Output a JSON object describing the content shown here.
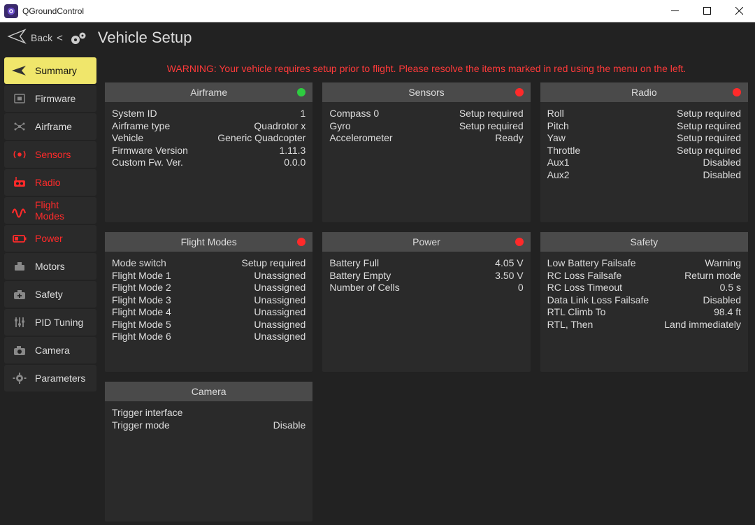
{
  "window": {
    "title": "QGroundControl"
  },
  "header": {
    "back": "Back",
    "title": "Vehicle Setup"
  },
  "warning": "WARNING: Your vehicle requires setup prior to flight. Please resolve the items marked in red using the menu on the left.",
  "sidebar": [
    {
      "id": "summary",
      "label": "Summary",
      "icon": "plane-icon",
      "selected": true,
      "warn": false
    },
    {
      "id": "firmware",
      "label": "Firmware",
      "icon": "chip-icon",
      "selected": false,
      "warn": false
    },
    {
      "id": "airframe",
      "label": "Airframe",
      "icon": "airframe-icon",
      "selected": false,
      "warn": false
    },
    {
      "id": "sensors",
      "label": "Sensors",
      "icon": "sensors-icon",
      "selected": false,
      "warn": true
    },
    {
      "id": "radio",
      "label": "Radio",
      "icon": "radio-icon",
      "selected": false,
      "warn": true
    },
    {
      "id": "flightmodes",
      "label": "Flight Modes",
      "icon": "wave-icon",
      "selected": false,
      "warn": true
    },
    {
      "id": "power",
      "label": "Power",
      "icon": "battery-icon",
      "selected": false,
      "warn": true
    },
    {
      "id": "motors",
      "label": "Motors",
      "icon": "motor-icon",
      "selected": false,
      "warn": false
    },
    {
      "id": "safety",
      "label": "Safety",
      "icon": "medkit-icon",
      "selected": false,
      "warn": false
    },
    {
      "id": "pidtuning",
      "label": "PID Tuning",
      "icon": "sliders-icon",
      "selected": false,
      "warn": false
    },
    {
      "id": "camera",
      "label": "Camera",
      "icon": "camera-icon",
      "selected": false,
      "warn": false
    },
    {
      "id": "parameters",
      "label": "Parameters",
      "icon": "gear-icon",
      "selected": false,
      "warn": false
    }
  ],
  "cards": [
    {
      "id": "airframe",
      "title": "Airframe",
      "status": "green",
      "rows": [
        {
          "k": "System ID",
          "v": "1"
        },
        {
          "k": "Airframe type",
          "v": "Quadrotor x"
        },
        {
          "k": "Vehicle",
          "v": "Generic Quadcopter"
        },
        {
          "k": "Firmware Version",
          "v": "1.11.3"
        },
        {
          "k": "Custom Fw. Ver.",
          "v": "0.0.0"
        }
      ]
    },
    {
      "id": "sensors",
      "title": "Sensors",
      "status": "red",
      "rows": [
        {
          "k": "Compass 0",
          "v": "Setup required"
        },
        {
          "k": "Gyro",
          "v": "Setup required"
        },
        {
          "k": "Accelerometer",
          "v": "Ready"
        }
      ]
    },
    {
      "id": "radio",
      "title": "Radio",
      "status": "red",
      "rows": [
        {
          "k": "Roll",
          "v": "Setup required"
        },
        {
          "k": "Pitch",
          "v": "Setup required"
        },
        {
          "k": "Yaw",
          "v": "Setup required"
        },
        {
          "k": "Throttle",
          "v": "Setup required"
        },
        {
          "k": "Aux1",
          "v": "Disabled"
        },
        {
          "k": "Aux2",
          "v": "Disabled"
        }
      ]
    },
    {
      "id": "flightmodes",
      "title": "Flight Modes",
      "status": "red",
      "rows": [
        {
          "k": "Mode switch",
          "v": "Setup required"
        },
        {
          "k": "Flight Mode 1",
          "v": "Unassigned"
        },
        {
          "k": "Flight Mode 2",
          "v": "Unassigned"
        },
        {
          "k": "Flight Mode 3",
          "v": "Unassigned"
        },
        {
          "k": "Flight Mode 4",
          "v": "Unassigned"
        },
        {
          "k": "Flight Mode 5",
          "v": "Unassigned"
        },
        {
          "k": "Flight Mode 6",
          "v": "Unassigned"
        }
      ]
    },
    {
      "id": "power",
      "title": "Power",
      "status": "red",
      "rows": [
        {
          "k": "Battery Full",
          "v": "4.05 V"
        },
        {
          "k": "Battery Empty",
          "v": "3.50 V"
        },
        {
          "k": "Number of Cells",
          "v": "0"
        }
      ]
    },
    {
      "id": "safety",
      "title": "Safety",
      "status": "none",
      "rows": [
        {
          "k": "Low Battery Failsafe",
          "v": "Warning"
        },
        {
          "k": "RC Loss Failsafe",
          "v": "Return mode"
        },
        {
          "k": "RC Loss Timeout",
          "v": "0.5 s"
        },
        {
          "k": "Data Link Loss Failsafe",
          "v": "Disabled"
        },
        {
          "k": "RTL Climb To",
          "v": "98.4 ft"
        },
        {
          "k": "RTL, Then",
          "v": "Land immediately"
        }
      ]
    },
    {
      "id": "camera",
      "title": "Camera",
      "status": "none",
      "rows": [
        {
          "k": "Trigger interface",
          "v": ""
        },
        {
          "k": "Trigger mode",
          "v": "Disable"
        }
      ]
    }
  ]
}
